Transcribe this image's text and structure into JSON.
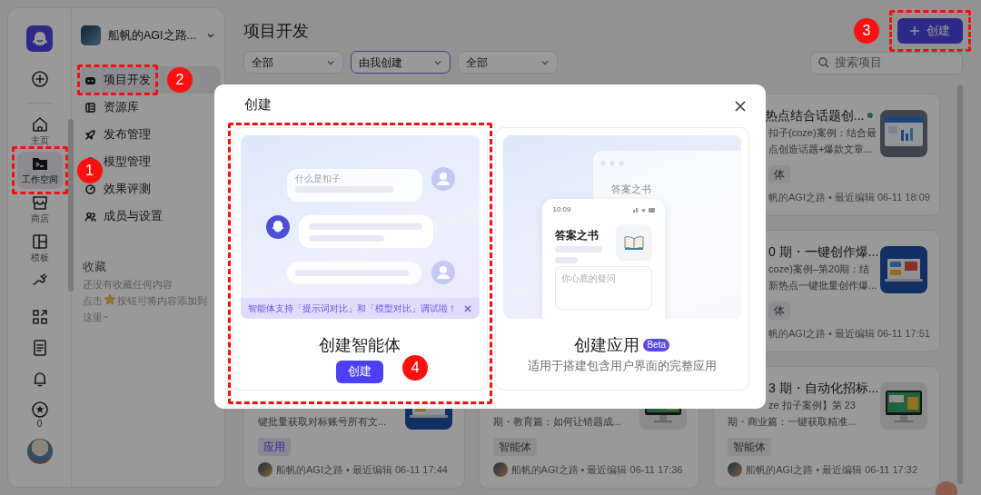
{
  "rail": {
    "items": [
      {
        "kind": "home",
        "label": "主页",
        "selected": false
      },
      {
        "kind": "workspace",
        "label": "工作空间",
        "selected": true
      },
      {
        "kind": "store",
        "label": "商店",
        "selected": false
      },
      {
        "kind": "template",
        "label": "模板",
        "selected": false
      },
      {
        "kind": "plugin",
        "selected": false
      }
    ],
    "tools": [
      {
        "kind": "apps"
      },
      {
        "kind": "docs"
      },
      {
        "kind": "notifications"
      },
      {
        "kind": "points",
        "count": "0"
      }
    ]
  },
  "workspace": {
    "name": "船帆的AGI之路..."
  },
  "menu": [
    {
      "kind": "project",
      "label": "项目开发",
      "selected": true
    },
    {
      "kind": "library",
      "label": "资源库",
      "selected": false
    },
    {
      "kind": "publish",
      "label": "发布管理",
      "selected": false
    },
    {
      "kind": "model",
      "label": "模型管理",
      "selected": false
    },
    {
      "kind": "evaluate",
      "label": "效果评测",
      "selected": false
    },
    {
      "kind": "members",
      "label": "成员与设置",
      "selected": false
    }
  ],
  "favorites": {
    "title": "收藏",
    "empty": "还没有收藏任何内容",
    "hint_before": "点击",
    "hint_after": "按钮可将内容添加到",
    "hint_end": "这里~"
  },
  "page": {
    "title": "项目开发",
    "create_button": "创建",
    "filters": [
      {
        "value": "全部",
        "focused": false
      },
      {
        "value": "由我创建",
        "focused": true
      },
      {
        "value": "全部",
        "focused": false
      }
    ],
    "search": {
      "placeholder": "搜索项目"
    }
  },
  "projects": {
    "column_1": [
      {
        "kind": "app",
        "description": [
          "键批量获取对标账号所有文..."
        ],
        "tag": "应用",
        "meta": "船帆的AGI之路 • 最近编辑 06-11 17:44",
        "avatar": true
      }
    ],
    "column_2": [
      {
        "kind": "agent",
        "description": [
          "期・教育篇：如何让错题成..."
        ],
        "tag": "智能体",
        "meta": "船帆的AGI之路 • 最近编辑 06-11 17:36",
        "avatar": true
      }
    ],
    "column_3": [
      {
        "kind": "agent",
        "title": "热点结合话题创...",
        "description": [
          "扣子(coze)案例：结合最",
          "点创造话题+爆款文章..."
        ],
        "tag": "体",
        "meta": "帆的AGI之路 • 最近编辑 06-11 18:09",
        "avatar": false,
        "published": true
      },
      {
        "kind": "agent",
        "title": "0 期・一键创作爆...",
        "description": [
          "coze)案例–第20期：结",
          "新热点一键批量创作爆..."
        ],
        "tag": "体",
        "meta": "帆的AGI之路 • 最近编辑 06-11 17:51",
        "avatar": false,
        "published": false
      },
      {
        "kind": "agent",
        "title": "3 期・自动化招标...",
        "description": [
          "ze 扣子案例】第 23",
          "期・商业篇：一键获取精准..."
        ],
        "tag": "智能体",
        "meta": "船帆的AGI之路 • 最近编辑 06-11 17:32",
        "avatar": true,
        "published": false
      }
    ]
  },
  "dialog": {
    "title": "创建",
    "options": [
      {
        "kind": "agent",
        "title": "创建智能体",
        "button": "创建",
        "illustration": {
          "question": "什么是扣子",
          "banner": "智能体支持「提示词对比」和「模型对比」调试啦！"
        }
      },
      {
        "kind": "app",
        "title": "创建应用",
        "badge": "Beta",
        "description": "适用于搭建包含用户界面的完整应用",
        "illustration": {
          "window_title": "答案之书",
          "time": "10:09",
          "app_title": "答案之书",
          "input_placeholder": "你心底的疑问"
        }
      }
    ]
  },
  "annotations": [
    {
      "number": "1",
      "kind": "rail"
    },
    {
      "number": "2",
      "kind": "menu"
    },
    {
      "number": "3",
      "kind": "create"
    },
    {
      "number": "4",
      "kind": "option"
    }
  ]
}
